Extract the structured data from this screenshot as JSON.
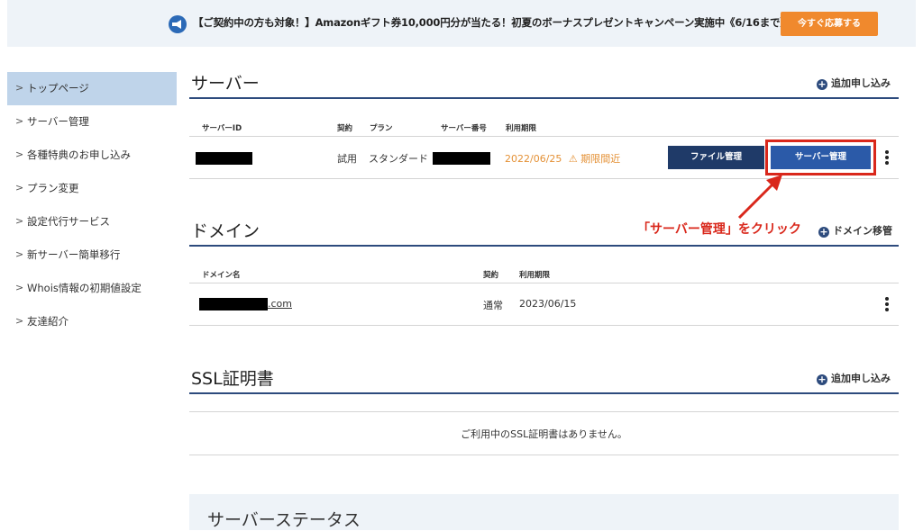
{
  "banner": {
    "text": "【ご契約中の方も対象！】Amazonギフト券10,000円分が当たる！初夏のボーナスプレゼントキャンペーン実施中《6/16まで》",
    "button": "今すぐ応募する",
    "icon": "megaphone-icon"
  },
  "sidebar": {
    "items": [
      {
        "label": "トップページ",
        "active": true
      },
      {
        "label": "サーバー管理"
      },
      {
        "label": "各種特典のお申し込み"
      },
      {
        "label": "プラン変更"
      },
      {
        "label": "設定代行サービス"
      },
      {
        "label": "新サーバー簡単移行"
      },
      {
        "label": "Whois情報の初期値設定"
      },
      {
        "label": "友達紹介"
      }
    ]
  },
  "server": {
    "title": "サーバー",
    "add_link": "追加申し込み",
    "headers": {
      "id": "サーバーID",
      "contract": "契約",
      "plan": "プラン",
      "number": "サーバー番号",
      "expiry": "利用期限"
    },
    "row": {
      "contract": "試用",
      "plan": "スタンダード",
      "expiry": "2022/06/25",
      "warning": "期限間近",
      "file_button": "ファイル管理",
      "server_button": "サーバー管理"
    }
  },
  "annotation": "「サーバー管理」をクリック",
  "domain": {
    "title": "ドメイン",
    "transfer_link": "ドメイン移管",
    "headers": {
      "name": "ドメイン名",
      "contract": "契約",
      "expiry": "利用期限"
    },
    "row": {
      "name_suffix": ".com",
      "contract": "通常",
      "expiry": "2023/06/15"
    }
  },
  "ssl": {
    "title": "SSL証明書",
    "add_link": "追加申し込み",
    "empty": "ご利用中のSSL証明書はありません。"
  },
  "status": {
    "title": "サーバーステータス"
  },
  "colors": {
    "accent": "#2d4b7d",
    "banner_button": "#f0892d",
    "highlight": "#d9271b",
    "warning": "#e49136"
  }
}
